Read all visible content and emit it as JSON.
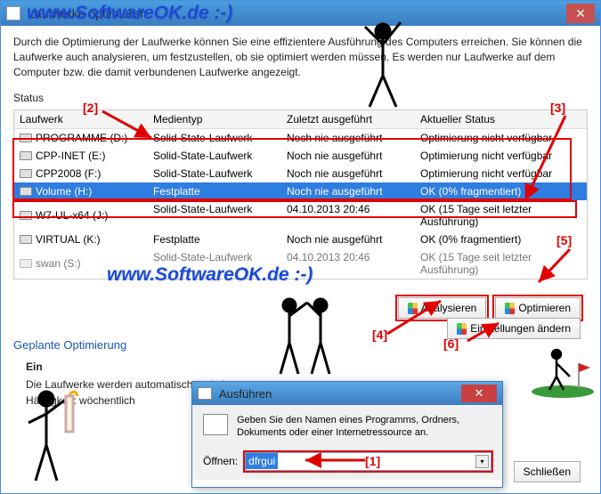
{
  "watermark": "www.SoftwareOK.de :-)",
  "window": {
    "title": "Laufwerke optimieren",
    "intro": "Durch die Optimierung der Laufwerke können Sie eine effizientere Ausführung des Computers erreichen. Sie können die Laufwerke auch analysieren, um festzustellen, ob sie optimiert werden müssen. Es werden nur Laufwerke auf dem Computer bzw. die damit verbundenen Laufwerke angezeigt.",
    "status_label": "Status",
    "columns": {
      "c1": "Laufwerk",
      "c2": "Medientyp",
      "c3": "Zuletzt ausgeführt",
      "c4": "Aktueller Status"
    },
    "rows": [
      {
        "c1": "PROGRAMME (D:)",
        "c2": "Solid-State-Laufwerk",
        "c3": "Noch nie ausgeführt",
        "c4": "Optimierung nicht verfügbar"
      },
      {
        "c1": "CPP-INET (E:)",
        "c2": "Solid-State-Laufwerk",
        "c3": "Noch nie ausgeführt",
        "c4": "Optimierung nicht verfügbar"
      },
      {
        "c1": "CPP2008 (F:)",
        "c2": "Solid-State-Laufwerk",
        "c3": "Noch nie ausgeführt",
        "c4": "Optimierung nicht verfügbar"
      },
      {
        "c1": "Volume (H:)",
        "c2": "Festplatte",
        "c3": "Noch nie ausgeführt",
        "c4": "OK (0% fragmentiert)"
      },
      {
        "c1": "W7-UL-x64 (J:)",
        "c2": "Solid-State-Laufwerk",
        "c3": "04.10.2013 20:46",
        "c4": "OK (15 Tage seit letzter Ausführung)"
      },
      {
        "c1": "VIRTUAL (K:)",
        "c2": "Festplatte",
        "c3": "Noch nie ausgeführt",
        "c4": "OK (0% fragmentiert)"
      },
      {
        "c1": "swan (S:)",
        "c2": "Solid-State-Laufwerk",
        "c3": "04.10.2013 20:46",
        "c4": "OK (15 Tage seit letzter Ausführung)"
      }
    ],
    "analyze": "Analysieren",
    "optimize": "Optimieren",
    "sched_heading": "Geplante Optimierung",
    "sched_state": "Ein",
    "sched_line1": "Die Laufwerke werden automatisch optimiert.",
    "sched_line2": "Häufigkeit: wöchentlich",
    "settings": "Einstellungen ändern",
    "close": "Schließen"
  },
  "run": {
    "title": "Ausführen",
    "desc": "Geben Sie den Namen eines Programms, Ordners, Dokuments oder einer Internetressource an.",
    "open_label": "Öffnen:",
    "value": "dfrgui"
  },
  "callouts": {
    "n1": "[1]",
    "n2": "[2]",
    "n3": "[3]",
    "n4": "[4]",
    "n5": "[5]",
    "n6": "[6]"
  }
}
